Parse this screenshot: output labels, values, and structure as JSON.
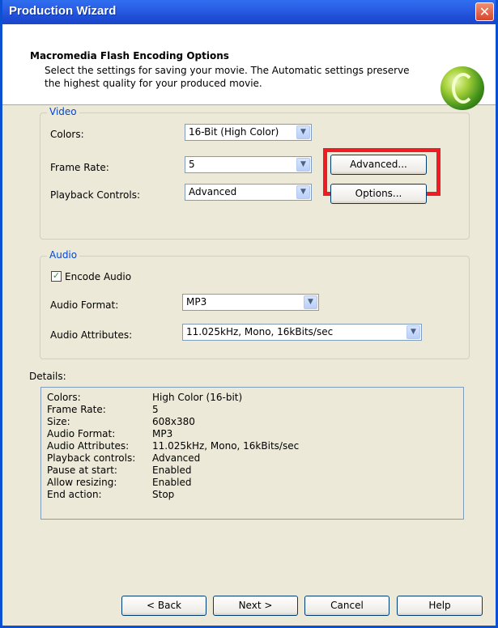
{
  "window": {
    "title": "Production Wizard",
    "close_glyph": "✕"
  },
  "header": {
    "title": "Macromedia Flash Encoding Options",
    "description": "Select the settings for saving your movie.  The Automatic settings preserve the highest quality for your produced movie.",
    "logo_icon": "flash-logo-icon"
  },
  "video": {
    "group_label": "Video",
    "colors_label": "Colors:",
    "colors_value": "16-Bit (High Color)",
    "frame_rate_label": "Frame Rate:",
    "frame_rate_value": "5",
    "playback_label": "Playback Controls:",
    "playback_value": "Advanced",
    "advanced_button": "Advanced...",
    "options_button": "Options..."
  },
  "audio": {
    "group_label": "Audio",
    "encode_label": "Encode Audio",
    "encode_checked": true,
    "format_label": "Audio Format:",
    "format_value": "MP3",
    "attributes_label": "Audio Attributes:",
    "attributes_value": "11.025kHz, Mono, 16kBits/sec"
  },
  "details": {
    "label": "Details:",
    "rows": [
      {
        "key": "Colors:",
        "value": "High Color (16-bit)"
      },
      {
        "key": "Frame Rate:",
        "value": "5"
      },
      {
        "key": "Size:",
        "value": "608x380"
      },
      {
        "key": "Audio Format:",
        "value": "MP3"
      },
      {
        "key": "Audio Attributes:",
        "value": "11.025kHz, Mono, 16kBits/sec"
      },
      {
        "key": "Playback controls:",
        "value": "Advanced"
      },
      {
        "key": "Pause at start:",
        "value": "Enabled"
      },
      {
        "key": "Allow resizing:",
        "value": "Enabled"
      },
      {
        "key": "End action:",
        "value": "Stop"
      }
    ]
  },
  "footer": {
    "back_button": "< Back",
    "next_button": "Next >",
    "cancel_button": "Cancel",
    "help_button": "Help"
  },
  "colors": {
    "titlebar": "#2a5fe6",
    "dialog_bg": "#ece9d8",
    "highlight": "#ee1c24",
    "group_label": "#0046d5"
  },
  "glyphs": {
    "dropdown": "▼",
    "check": "✓"
  }
}
